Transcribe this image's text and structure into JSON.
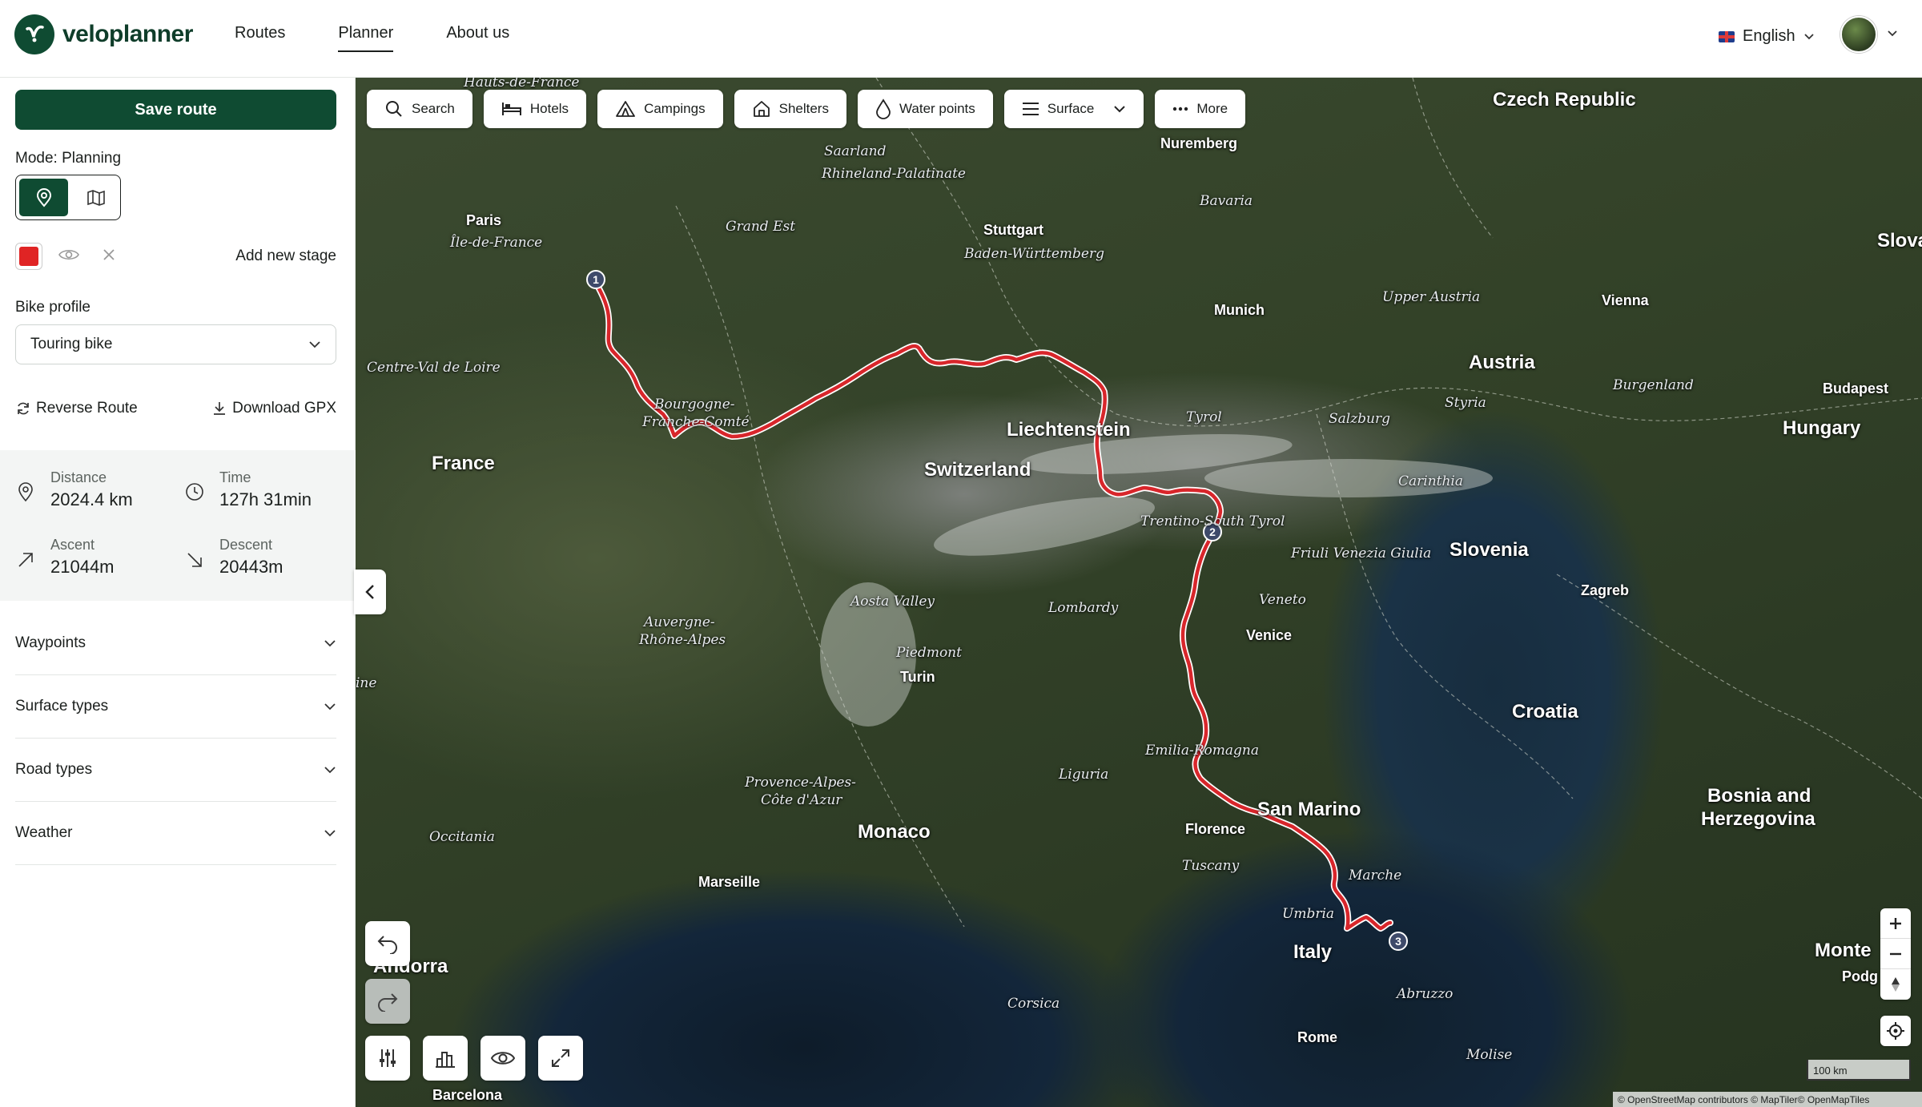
{
  "app": {
    "name": "veloplanner"
  },
  "nav": {
    "routes": "Routes",
    "planner": "Planner",
    "about": "About us"
  },
  "language": "English",
  "sidebar": {
    "save_label": "Save route",
    "mode_label": "Mode: Planning",
    "add_stage_label": "Add new stage",
    "stage_color": "#e02424",
    "bike_profile_label": "Bike profile",
    "bike_profile_value": "Touring bike",
    "reverse_label": "Reverse Route",
    "download_label": "Download GPX",
    "stats": {
      "distance_label": "Distance",
      "distance_value": "2024.4 km",
      "time_label": "Time",
      "time_value": "127h 31min",
      "ascent_label": "Ascent",
      "ascent_value": "21044m",
      "descent_label": "Descent",
      "descent_value": "20443m"
    },
    "sections": [
      "Waypoints",
      "Surface types",
      "Road types",
      "Weather"
    ]
  },
  "map_toolbar": [
    "Search",
    "Hotels",
    "Campings",
    "Shelters",
    "Water points",
    "Surface",
    "More"
  ],
  "map_labels": {
    "countries": [
      "Czech Republic",
      "Slovak",
      "Austria",
      "Hungary",
      "Liechtenstein",
      "Switzerland",
      "France",
      "Slovenia",
      "Croatia",
      "San Marino",
      "Bosnia and",
      "Herzegovina",
      "Monaco",
      "Italy",
      "Andorra",
      "Monte"
    ],
    "regions": [
      "Hauts-de-France",
      "Saarland",
      "Rhineland-Palatinate",
      "Bavaria",
      "Grand Est",
      "Baden-Württemberg",
      "Île-de-France",
      "Upper Austria",
      "Centre-Val de Loire",
      "Bourgogne-",
      "Franche-Comté",
      "Tyrol",
      "Salzburg",
      "Styria",
      "Burgenland",
      "Carinthia",
      "Trentino-South Tyrol",
      "Friuli Venezia Giulia",
      "Aosta Valley",
      "Lombardy",
      "Veneto",
      "Auvergne-",
      "Rhône-Alpes",
      "Piedmont",
      "Emilia-Romagna",
      "Provence-Alpes-",
      "Côte d'Azur",
      "Liguria",
      "Occitania",
      "Tuscany",
      "Marche",
      "Umbria",
      "Corsica",
      "Abruzzo",
      "Molise",
      "ine"
    ],
    "cities": [
      "Nuremberg",
      "Paris",
      "Stuttgart",
      "Munich",
      "Vienna",
      "Budapest",
      "Zagreb",
      "Venice",
      "Turin",
      "Florence",
      "Marseille",
      "Rome",
      "Barcelona",
      "Podg"
    ]
  },
  "waypoints": [
    "1",
    "2",
    "3"
  ],
  "map_meta": {
    "scale_label": "100 km",
    "attribution": "© OpenStreetMap contributors © MapTiler© OpenMapTiles",
    "route_color": "#d8262b"
  }
}
